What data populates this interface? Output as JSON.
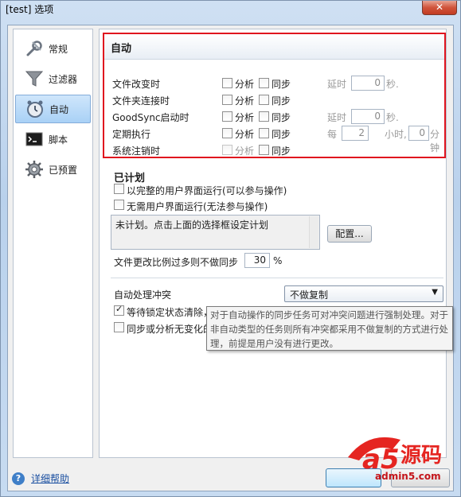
{
  "window": {
    "title": "[test] 选项",
    "close_glyph": "✕"
  },
  "sidebar": {
    "items": [
      {
        "label": "常规",
        "icon": "wrench-icon"
      },
      {
        "label": "过滤器",
        "icon": "funnel-icon"
      },
      {
        "label": "自动",
        "icon": "clock-icon",
        "active": true
      },
      {
        "label": "脚本",
        "icon": "script-icon"
      },
      {
        "label": "已预置",
        "icon": "gear-icon"
      }
    ]
  },
  "auto": {
    "title": "自动",
    "rows": [
      {
        "label": "文件改变时",
        "analyze": "分析",
        "sync": "同步",
        "delay_label": "延时",
        "delay_value": "0",
        "delay_unit": "秒."
      },
      {
        "label": "文件夹连接时",
        "analyze": "分析",
        "sync": "同步"
      },
      {
        "label": "GoodSync启动时",
        "analyze": "分析",
        "sync": "同步",
        "delay_label": "延时",
        "delay_value": "0",
        "delay_unit": "秒."
      },
      {
        "label": "定期执行",
        "analyze": "分析",
        "sync": "同步",
        "every_label": "每",
        "hours_value": "2",
        "hours_unit": "小时,",
        "minutes_value": "0",
        "minutes_unit": "分钟"
      },
      {
        "label": "系统注销时",
        "analyze": "分析",
        "sync": "同步"
      }
    ]
  },
  "scheduled": {
    "title": "已计划",
    "option_full_ui": "以完整的用户界面运行(可以参与操作)",
    "option_no_ui": "无需用户界面运行(无法参与操作)",
    "schedule_text": "未计划。点击上面的选择框设定计划",
    "configure_button": "配置...",
    "ratio_label": "文件更改比例过多则不做同步",
    "ratio_value": "30",
    "ratio_unit": "%"
  },
  "conflict": {
    "label": "自动处理冲突",
    "selected": "不做复制",
    "wait_label": "等待锁定状态清除，",
    "wait_checked": true,
    "no_change_label": "同步或分析无变化的"
  },
  "tooltip": {
    "text": "对于自动操作的同步任务可对冲突问题进行强制处理。对于非自动类型的任务则所有冲突都采用不做复制的方式进行处理，前提是用户没有进行更改。"
  },
  "footer": {
    "help_label": "详细帮助"
  },
  "watermark": {
    "text_a5": "a5",
    "text_yuanma": "源码",
    "site": "admin5.com"
  },
  "colors": {
    "highlight_border": "#e0141e",
    "select_active_bg": "#a9d1f6"
  }
}
